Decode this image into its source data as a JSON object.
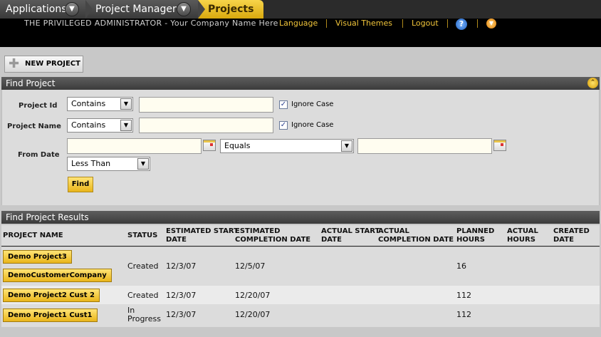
{
  "breadcrumb": {
    "items": [
      {
        "label": "Applications"
      },
      {
        "label": "Project Manager"
      },
      {
        "label": "Projects"
      }
    ]
  },
  "header": {
    "user_text": "THE PRIVILEGED ADMINISTRATOR - Your Company Name Here",
    "links": [
      "Language",
      "Visual Themes",
      "Logout"
    ],
    "help_icon": "?",
    "menu_icon": "▼"
  },
  "toolbar": {
    "new_project_label": "NEW PROJECT"
  },
  "find_panel": {
    "title": "Find Project",
    "collapse_glyph": "⌃",
    "project_id": {
      "label": "Project Id",
      "operator": "Contains",
      "value": "",
      "ignore_case_label": "Ignore Case",
      "ignore_case": true
    },
    "project_name": {
      "label": "Project Name",
      "operator": "Contains",
      "value": "",
      "ignore_case_label": "Ignore Case",
      "ignore_case": true
    },
    "from_date": {
      "label": "From Date",
      "value": "",
      "operator": "Equals",
      "value2": "",
      "operator2": "Less Than"
    },
    "find_button": "Find",
    "select_arrow": "▼",
    "check_mark": "✓"
  },
  "results": {
    "title": "Find Project Results",
    "columns": [
      {
        "l1": "PROJECT NAME",
        "l2": ""
      },
      {
        "l1": "STATUS",
        "l2": ""
      },
      {
        "l1": "ESTIMATED START",
        "l2": "DATE"
      },
      {
        "l1": "ESTIMATED",
        "l2": "COMPLETION DATE"
      },
      {
        "l1": "ACTUAL START",
        "l2": "DATE"
      },
      {
        "l1": "ACTUAL",
        "l2": "COMPLETION DATE"
      },
      {
        "l1": "PLANNED",
        "l2": "HOURS"
      },
      {
        "l1": "ACTUAL",
        "l2": "HOURS"
      },
      {
        "l1": "CREATED",
        "l2": "DATE"
      }
    ],
    "rows": [
      {
        "name": "Demo Project3",
        "customer": "DemoCustomerCompany",
        "status": "Created",
        "status2": "",
        "est_start": "12/3/07",
        "est_completion": "12/5/07",
        "planned_hours": "16"
      },
      {
        "name": "Demo Project2 Cust 2",
        "customer": "",
        "status": "Created",
        "status2": "",
        "est_start": "12/3/07",
        "est_completion": "12/20/07",
        "planned_hours": "112"
      },
      {
        "name": "Demo Project1 Cust1",
        "customer": "",
        "status": "In",
        "status2": "Progress",
        "est_start": "12/3/07",
        "est_completion": "12/20/07",
        "planned_hours": "112"
      }
    ]
  },
  "colors": {
    "accent": "#f0c43a",
    "header_bg": "#000000",
    "panel_header": "#4a4a4a"
  }
}
